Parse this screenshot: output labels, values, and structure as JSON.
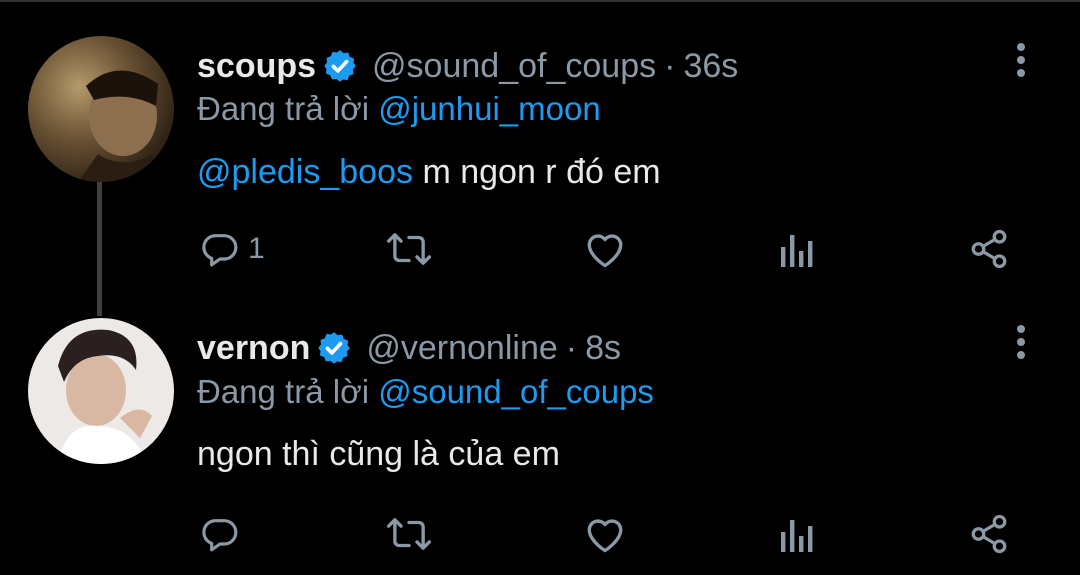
{
  "tweets": [
    {
      "name": "scoups",
      "handle": "@sound_of_coups",
      "separator": "·",
      "time": "36s",
      "reply_label": "Đang trả lời",
      "reply_to": "@junhui_moon",
      "mention": "@pledis_boos",
      "text": " m ngon r đó em",
      "reply_count": "1"
    },
    {
      "name": "vernon",
      "handle": "@vernonline",
      "separator": "·",
      "time": "8s",
      "reply_label": "Đang trả lời",
      "reply_to": "@sound_of_coups",
      "text": "ngon thì cũng là của em",
      "reply_count": ""
    }
  ],
  "icons": {
    "verified": "verified-badge-icon",
    "more": "more-vertical-icon",
    "reply": "reply-icon",
    "retweet": "retweet-icon",
    "like": "heart-icon",
    "views": "analytics-icon",
    "share": "share-icon"
  },
  "colors": {
    "background": "#000000",
    "text": "#e7e9ea",
    "secondary": "#8b98a5",
    "accent": "#1d9bf0",
    "thread_line": "#3e4144"
  }
}
